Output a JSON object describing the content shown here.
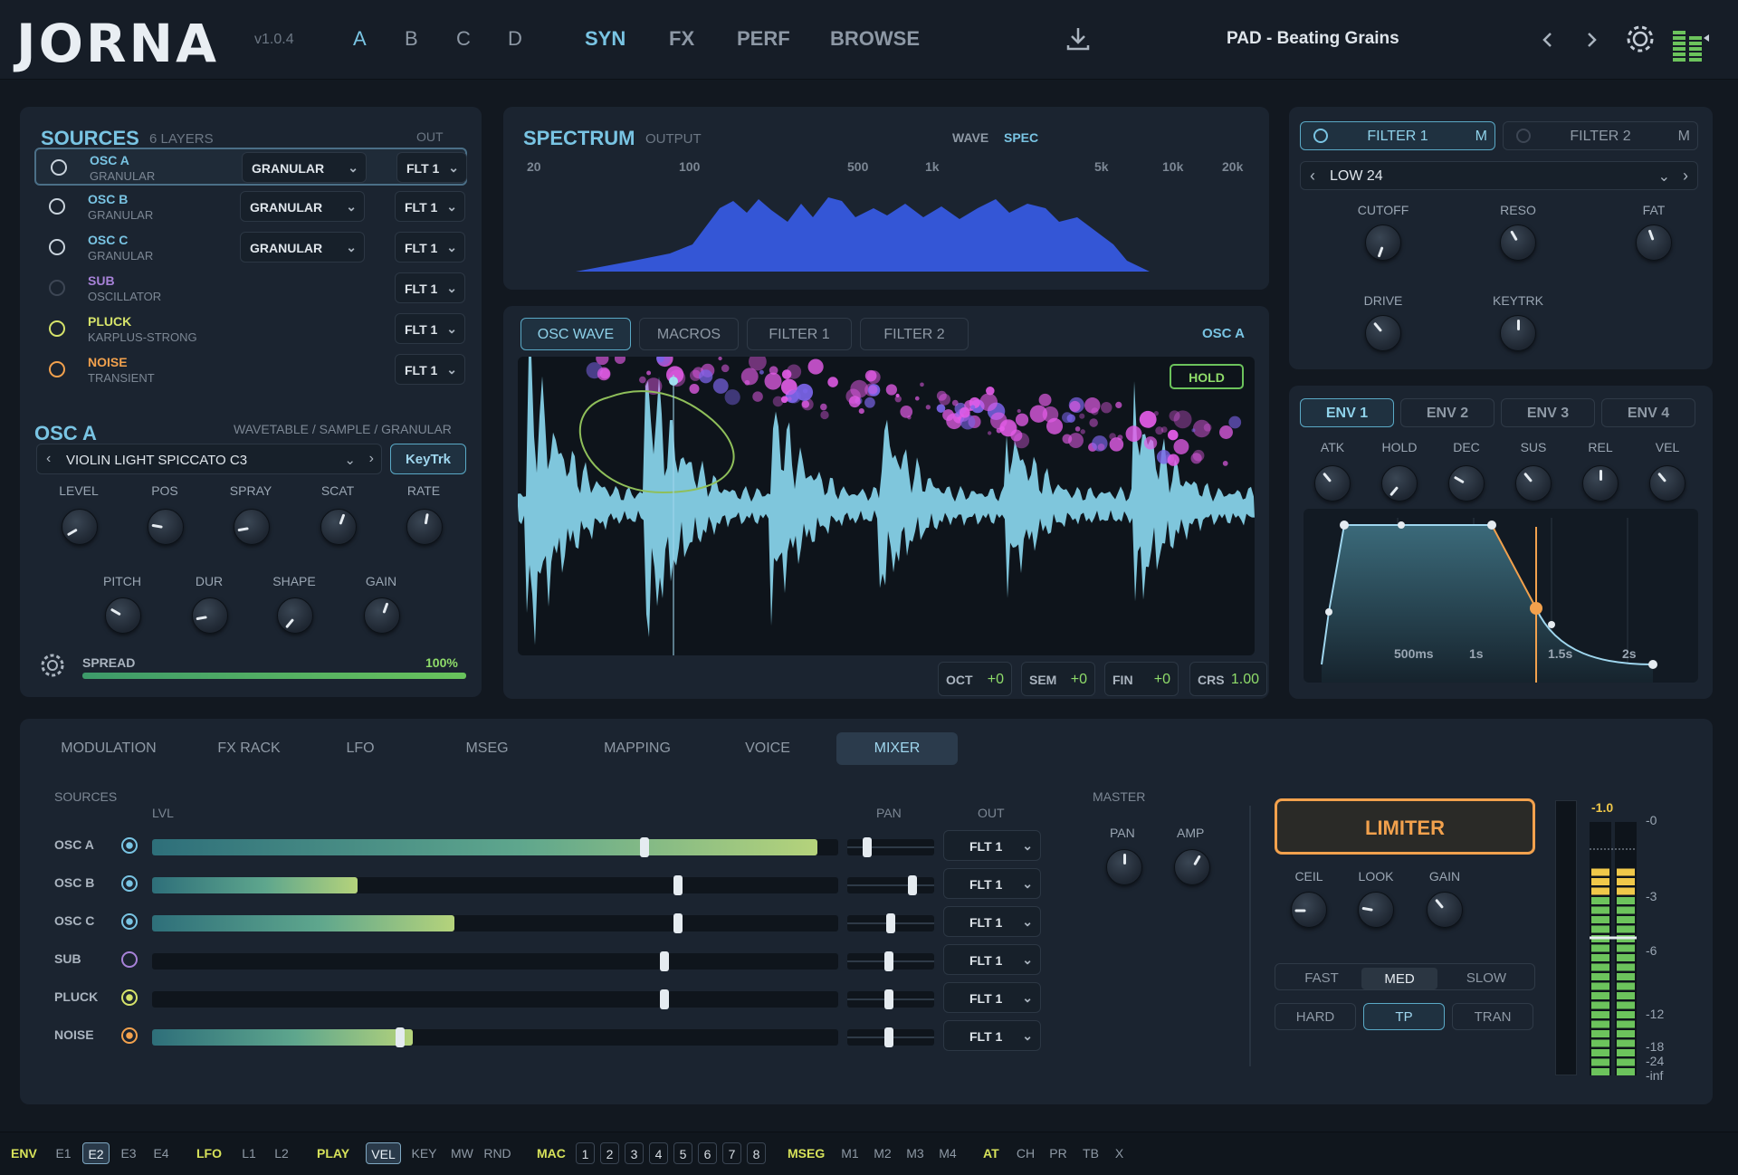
{
  "header": {
    "logo": "JORNA",
    "version": "v1.0.4",
    "slots": [
      "A",
      "B",
      "C",
      "D"
    ],
    "nav": [
      "SYN",
      "FX",
      "PERF",
      "BROWSE"
    ],
    "preset": "PAD - Beating Grains",
    "icons": [
      "download-icon",
      "chevron-left-icon",
      "chevron-right-icon",
      "gear-icon",
      "level-meter-icon"
    ]
  },
  "sources": {
    "title": "SOURCES",
    "count": "6 LAYERS",
    "out_label": "OUT",
    "layers": [
      {
        "name": "OSC A",
        "type": "GRANULAR",
        "mode": "GRANULAR",
        "out": "FLT 1",
        "color": "#79c4e3",
        "ring": "#c9d3dc"
      },
      {
        "name": "OSC B",
        "type": "GRANULAR",
        "mode": "GRANULAR",
        "out": "FLT 1",
        "color": "#79c4e3",
        "ring": "#c9d3dc"
      },
      {
        "name": "OSC C",
        "type": "GRANULAR",
        "mode": "GRANULAR",
        "out": "FLT 1",
        "color": "#79c4e3",
        "ring": "#c9d3dc"
      },
      {
        "name": "SUB",
        "type": "OSCILLATOR",
        "mode": "",
        "out": "FLT 1",
        "color": "#a782d8",
        "ring": "#3d4654"
      },
      {
        "name": "PLUCK",
        "type": "KARPLUS-STRONG",
        "mode": "",
        "out": "FLT 1",
        "color": "#d6e36a",
        "ring": "#d6e36a"
      },
      {
        "name": "NOISE",
        "type": "TRANSIENT",
        "mode": "",
        "out": "FLT 1",
        "color": "#f2a14d",
        "ring": "#f2a14d"
      }
    ]
  },
  "osca": {
    "title": "OSC A",
    "subtitle": "WAVETABLE / SAMPLE / GRANULAR",
    "sample": "VIOLIN LIGHT SPICCATO C3",
    "keytrk": "KeyTrk",
    "knobs1": [
      "LEVEL",
      "POS",
      "SPRAY",
      "SCAT",
      "RATE"
    ],
    "knobs2": [
      "PITCH",
      "DUR",
      "SHAPE",
      "GAIN"
    ],
    "spread_label": "SPREAD",
    "spread_value": "100%",
    "spread": 1.0
  },
  "spectrum": {
    "title": "SPECTRUM",
    "subtitle": "OUTPUT",
    "wave": "WAVE",
    "spec": "SPEC",
    "ticks": [
      "20",
      "100",
      "500",
      "1k",
      "5k",
      "10k",
      "20k"
    ]
  },
  "display": {
    "tabs": [
      "OSC WAVE",
      "MACROS",
      "FILTER 1",
      "FILTER 2"
    ],
    "target": "OSC A",
    "hold": "HOLD",
    "tuning": [
      {
        "k": "OCT",
        "v": "+0"
      },
      {
        "k": "SEM",
        "v": "+0"
      },
      {
        "k": "FIN",
        "v": "+0"
      },
      {
        "k": "CRS",
        "v": "1.00"
      }
    ]
  },
  "filter": {
    "tabs": [
      "FILTER 1",
      "FILTER 2"
    ],
    "m": "M",
    "type": "LOW 24",
    "knobs": [
      "CUTOFF",
      "RESO",
      "FAT",
      "DRIVE",
      "KEYTRK"
    ]
  },
  "env": {
    "tabs": [
      "ENV 1",
      "ENV 2",
      "ENV 3",
      "ENV 4"
    ],
    "knobs": [
      "ATK",
      "HOLD",
      "DEC",
      "SUS",
      "REL",
      "VEL"
    ],
    "times": [
      "500ms",
      "1s",
      "1.5s",
      "2s"
    ]
  },
  "bottom": {
    "tabs": [
      "MODULATION",
      "FX RACK",
      "LFO",
      "MSEG",
      "MAPPING",
      "VOICE",
      "MIXER"
    ],
    "sources_label": "SOURCES",
    "lvl": "LVL",
    "pan": "PAN",
    "out": "OUT",
    "master": "MASTER",
    "amp": "AMP",
    "rows": [
      {
        "name": "OSC A",
        "level": 0.97,
        "thumb": 0.72,
        "pan": 0.2,
        "out": "FLT 1",
        "ring": "#79c4e3"
      },
      {
        "name": "OSC B",
        "level": 0.3,
        "thumb": 0.77,
        "pan": 0.78,
        "out": "FLT 1",
        "ring": "#79c4e3"
      },
      {
        "name": "OSC C",
        "level": 0.44,
        "thumb": 0.77,
        "pan": 0.5,
        "out": "FLT 1",
        "ring": "#79c4e3"
      },
      {
        "name": "SUB",
        "level": 0,
        "thumb": 0.75,
        "pan": 0.48,
        "out": "FLT 1",
        "ring": "#a782d8"
      },
      {
        "name": "PLUCK",
        "level": 0,
        "thumb": 0.75,
        "pan": 0.48,
        "out": "FLT 1",
        "ring": "#d6e36a"
      },
      {
        "name": "NOISE",
        "level": 0.38,
        "thumb": 0.36,
        "pan": 0.48,
        "out": "FLT 1",
        "ring": "#f2a14d"
      }
    ],
    "limiter": "LIMITER",
    "lim_knobs": [
      "CEIL",
      "LOOK",
      "GAIN"
    ],
    "speeds": [
      "FAST",
      "MED",
      "SLOW"
    ],
    "modes": [
      "HARD",
      "TP",
      "TRAN"
    ],
    "meter_value": "-1.0",
    "meter_scale": [
      "-0",
      "-3",
      "-6",
      "-12",
      "-18",
      "-24",
      "-inf"
    ]
  },
  "footer": {
    "env": "ENV",
    "envs": [
      "E1",
      "E2",
      "E3",
      "E4"
    ],
    "lfo": "LFO",
    "lfos": [
      "L1",
      "L2"
    ],
    "play": "PLAY",
    "plays": [
      "VEL",
      "KEY",
      "MW",
      "RND"
    ],
    "mac": "MAC",
    "macs": [
      "1",
      "2",
      "3",
      "4",
      "5",
      "6",
      "7",
      "8"
    ],
    "mseg": "MSEG",
    "msegs": [
      "M1",
      "M2",
      "M3",
      "M4"
    ],
    "at": "AT",
    "ats": [
      "CH",
      "PR",
      "TB",
      "X"
    ]
  },
  "colors": {
    "accent": "#79c4e3",
    "limiter": "#f2a14d",
    "spectrum": "#3a5fd8",
    "wave": "#7fc6dc",
    "particles": "#e45ce8"
  }
}
